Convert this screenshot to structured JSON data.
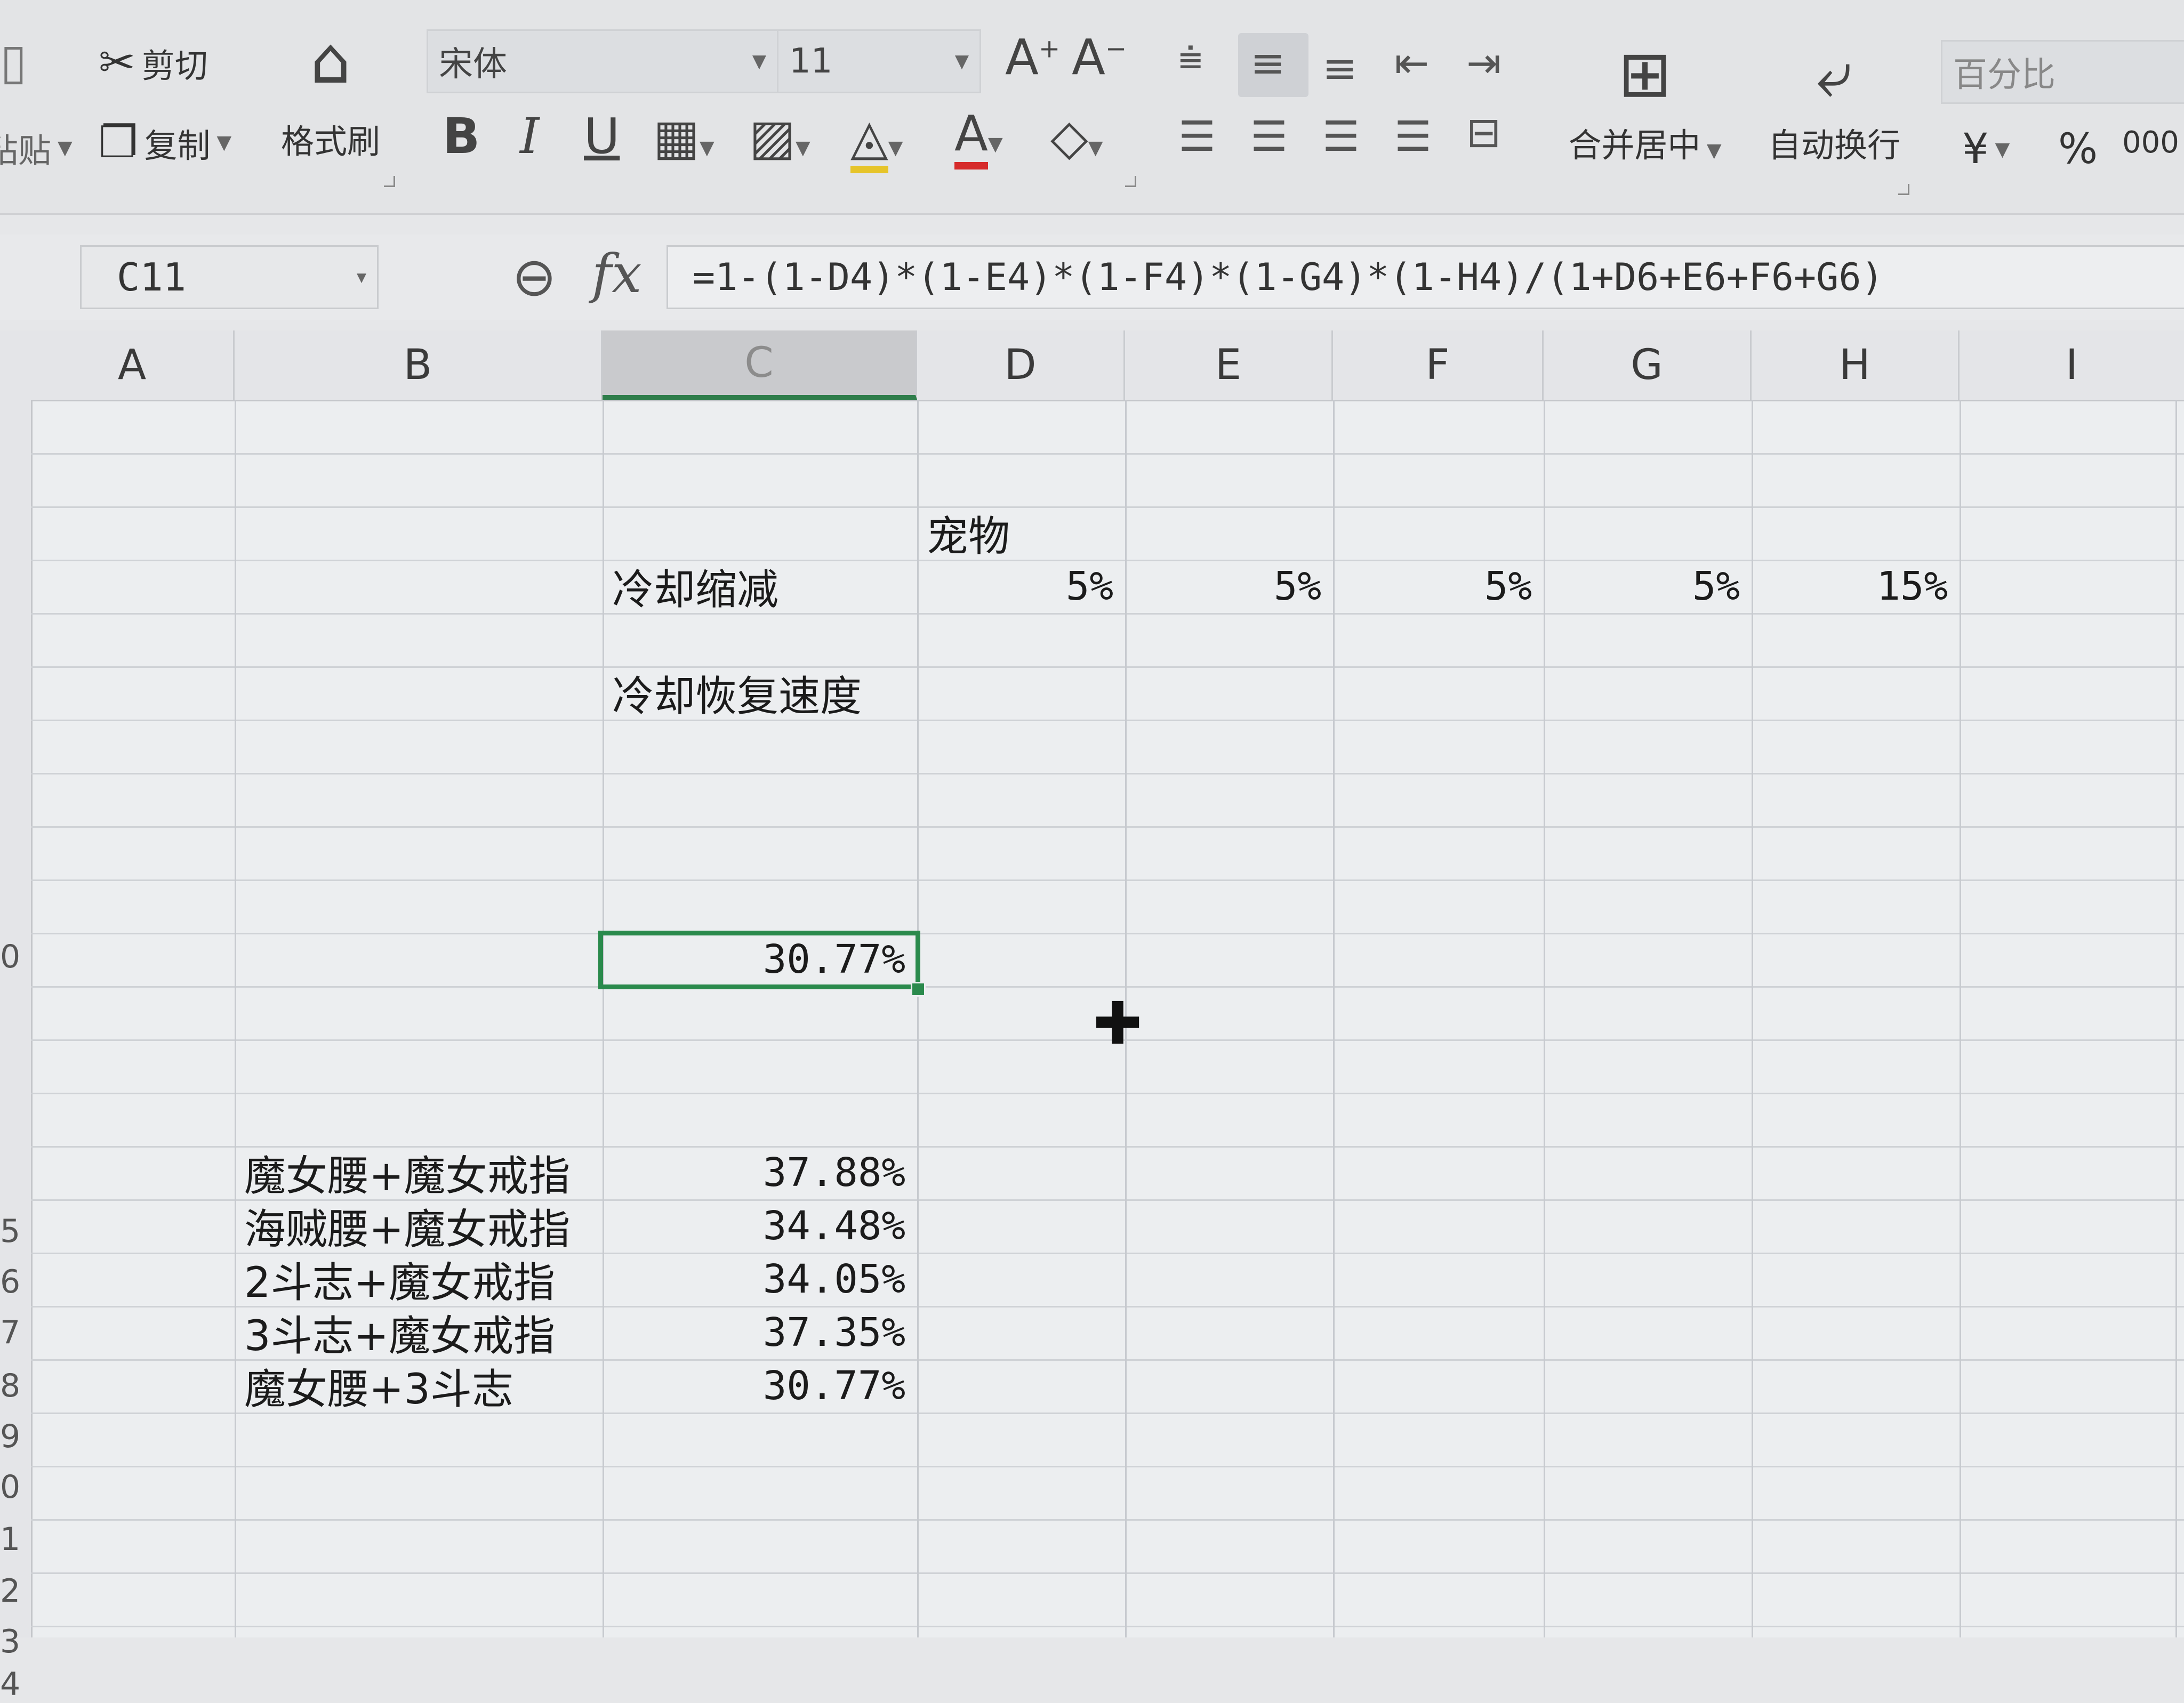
{
  "toolbar": {
    "paste_label": "粘贴",
    "cut_label": "剪切",
    "copy_label": "复制",
    "format_painter_label": "格式刷",
    "font_name": "宋体",
    "font_size": "11",
    "bold_label": "B",
    "italic_label": "I",
    "underline_label": "U",
    "merge_center_label": "合并居中",
    "auto_wrap_label": "自动换行",
    "number_format": "百分比",
    "currency_label": "¥",
    "percent_label": "%",
    "thousands_label": "000"
  },
  "formula_bar": {
    "name_box": "C11",
    "fx_label": "fx",
    "formula": "=1-(1-D4)*(1-E4)*(1-F4)*(1-G4)*(1-H4)/(1+D6+E6+F6+G6)"
  },
  "columns": [
    "A",
    "B",
    "C",
    "D",
    "E",
    "F",
    "G",
    "H",
    "I"
  ],
  "selected_column": "C",
  "cells": {
    "pet_header": "宠物",
    "cooldown_reduction_label": "冷却缩减",
    "cooldown_reduction_values": [
      "5%",
      "5%",
      "5%",
      "5%",
      "15%"
    ],
    "cooldown_recovery_label": "冷却恢复速度",
    "active_value": "30.77%",
    "combos": [
      {
        "name": "魔女腰+魔女戒指",
        "value": "37.88%"
      },
      {
        "name": "海贼腰+魔女戒指",
        "value": "34.48%"
      },
      {
        "name": "2斗志+魔女戒指",
        "value": "34.05%"
      },
      {
        "name": "3斗志+魔女戒指",
        "value": "37.35%"
      },
      {
        "name": "魔女腰+3斗志",
        "value": "30.77%"
      }
    ]
  },
  "row_marks": [
    "0",
    "5",
    "6",
    "7",
    "8",
    "9",
    "0",
    "1",
    "2",
    "3",
    "4"
  ]
}
